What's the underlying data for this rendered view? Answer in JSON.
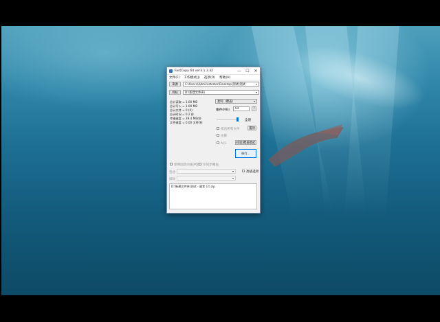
{
  "window": {
    "title": "FastCopy 64 ver3.1.3.32",
    "min_glyph": "—",
    "max_glyph": "☐",
    "close_glyph": "✕"
  },
  "menu": [
    "文件(F)",
    "工作模式(J)",
    "选项(O)",
    "帮助(H)"
  ],
  "source": {
    "button_label": "来源",
    "value": "C:\\Users\\Administrator\\Desktop\\测试\\测试"
  },
  "destination": {
    "button_label": "目标",
    "value": "D:\\新建文件夹\\"
  },
  "stats": [
    "总计读取 = 1.00 MB",
    "总计写入 = 1.00 MB",
    "总计文件 = 0 (0)",
    "总计时间 = 0.2 秒",
    "传输速度 = 39.4 MB/秒",
    "文件速度 = 0.00 文件/秒"
  ],
  "mode": {
    "value": "复制（覆盖）"
  },
  "buffer": {
    "label": "缓存(MB)",
    "value": "64",
    "help": "?"
  },
  "full_speed_label": "全速",
  "checks": {
    "verify": "校验所有文件",
    "estimate": "估算",
    "acl": "ACL",
    "nonstop": "不停止",
    "list_label": "列表",
    "filter_label": "过滤",
    "top_label": "置顶",
    "extra_a": "使用固定的缓冲区",
    "extra_b": "仅同步覆盖"
  },
  "buttons": {
    "top": "置顶",
    "list_mode": "校验/覆盖模式",
    "execute": "执行..."
  },
  "include_label": "包含",
  "exclude_label": "排除",
  "filter_toggle": "高级选项",
  "status_line": "D:\\新建文件夹\\测试 - 副本 (2).zip",
  "colors": {
    "accent": "#0078d7",
    "window_bg": "#f0f0f0"
  }
}
